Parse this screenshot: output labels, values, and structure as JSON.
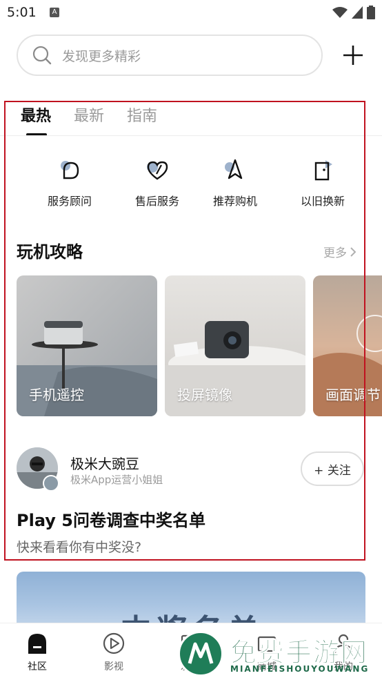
{
  "status_bar": {
    "time": "5:01",
    "notification_letter": "A"
  },
  "search": {
    "placeholder": "发现更多精彩"
  },
  "tabs": [
    {
      "label": "最热",
      "active": true
    },
    {
      "label": "最新",
      "active": false
    },
    {
      "label": "指南",
      "active": false
    }
  ],
  "services": [
    {
      "label": "服务顾问",
      "icon": "chat-bubble-icon"
    },
    {
      "label": "售后服务",
      "icon": "heart-icon"
    },
    {
      "label": "推荐购机",
      "icon": "rocket-icon"
    },
    {
      "label": "以旧换新",
      "icon": "door-icon"
    }
  ],
  "guides": {
    "title": "玩机攻略",
    "more_label": "更多",
    "cards": [
      {
        "label": "手机遥控"
      },
      {
        "label": "投屏镜像"
      },
      {
        "label": "画面调节"
      }
    ]
  },
  "post": {
    "author": "极米大豌豆",
    "author_role": "极米App运营小姐姐",
    "follow_label": "+ 关注",
    "title": "Play 5问卷调查中奖名单",
    "subtitle": "快来看看你有中奖没?"
  },
  "banner": {
    "text": "中奖名单"
  },
  "bottom_nav": [
    {
      "label": "社区",
      "icon": "community-icon",
      "active": true
    },
    {
      "label": "影视",
      "icon": "play-circle-icon",
      "active": false
    },
    {
      "label": "发现",
      "icon": "device-icon",
      "active": false
    },
    {
      "label": "商城",
      "icon": "shop-icon",
      "active": false
    },
    {
      "label": "我的",
      "icon": "profile-icon",
      "active": false
    }
  ],
  "watermark": {
    "title": "免费手游网",
    "subtitle": "MIANFEISHOUYOUWANG"
  },
  "colors": {
    "accent": "#111111",
    "highlight_border": "#c0111f",
    "muted": "#9a9a9a",
    "watermark_green": "#1f7d58"
  }
}
